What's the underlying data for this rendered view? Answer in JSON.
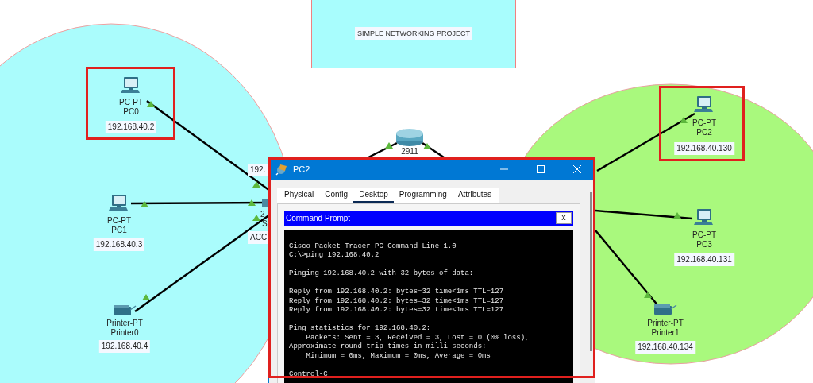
{
  "title_label": "SIMPLE NETWORKING PROJECT",
  "devices": [
    {
      "kind": "pc",
      "model": "PC-PT",
      "name": "PC0",
      "ip": "192.168.40.2",
      "highlighted": true
    },
    {
      "kind": "pc",
      "model": "PC-PT",
      "name": "PC1",
      "ip": "192.168.40.3",
      "highlighted": false
    },
    {
      "kind": "printer",
      "model": "Printer-PT",
      "name": "Printer0",
      "ip": "192.168.40.4",
      "highlighted": false
    },
    {
      "kind": "pc",
      "model": "PC-PT",
      "name": "PC2",
      "ip": "192.168.40.130",
      "highlighted": true
    },
    {
      "kind": "pc",
      "model": "PC-PT",
      "name": "PC3",
      "ip": "192.168.40.131",
      "highlighted": false
    },
    {
      "kind": "printer",
      "model": "Printer-PT",
      "name": "Printer1",
      "ip": "192.168.40.134",
      "highlighted": false
    }
  ],
  "router": {
    "label": "2911"
  },
  "switch": {
    "ip": "192.",
    "model": "2",
    "name": "S",
    "vlan": "ACC"
  },
  "window": {
    "title": "PC2",
    "highlighted": true,
    "tabs": [
      {
        "label": "Physical",
        "selected": false
      },
      {
        "label": "Config",
        "selected": false
      },
      {
        "label": "Desktop",
        "selected": true
      },
      {
        "label": "Programming",
        "selected": false
      },
      {
        "label": "Attributes",
        "selected": false
      }
    ],
    "panel_title": "Command Prompt",
    "panel_close": "X",
    "terminal_output": "\nCisco Packet Tracer PC Command Line 1.0\nC:\\>ping 192.168.40.2\n\nPinging 192.168.40.2 with 32 bytes of data:\n\nReply from 192.168.40.2: bytes=32 time<1ms TTL=127\nReply from 192.168.40.2: bytes=32 time<1ms TTL=127\nReply from 192.168.40.2: bytes=32 time<1ms TTL=127\n\nPing statistics for 192.168.40.2:\n    Packets: Sent = 3, Received = 3, Lost = 0 (0% loss),\nApproximate round trip times in milli-seconds:\n    Minimum = 0ms, Maximum = 0ms, Average = 0ms\n\nControl-C"
  }
}
